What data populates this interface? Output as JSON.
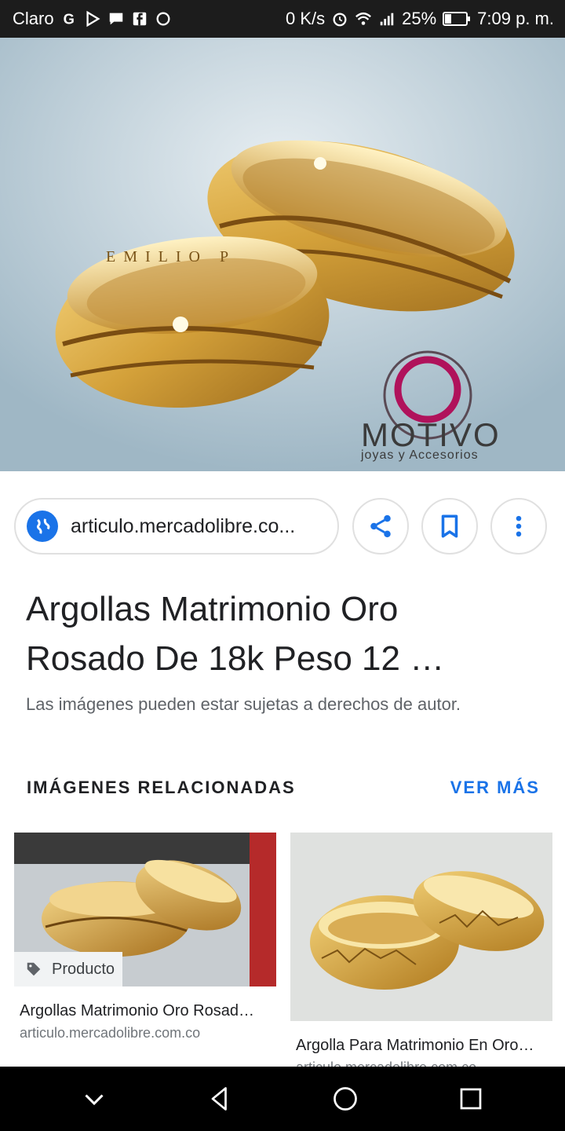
{
  "status_bar": {
    "carrier": "Claro",
    "net_speed": "0 K/s",
    "battery": "25%",
    "time": "7:09 p. m."
  },
  "hero": {
    "brand": "MOTIVO",
    "brand_sub": "joyas y Accesorios",
    "engraving": "EMILIO P"
  },
  "actions": {
    "url": "articulo.mercadolibre.co..."
  },
  "title": {
    "line1": "Argollas Matrimonio Oro",
    "line2": "Rosado De 18k Peso 12 …"
  },
  "copyright_notice": "Las imágenes pueden estar sujetas a derechos de autor.",
  "related": {
    "heading": "IMÁGENES RELACIONADAS",
    "more": "VER MÁS",
    "items": [
      {
        "tag": "Producto",
        "title": "Argollas Matrimonio Oro Rosad…",
        "source": "articulo.mercadolibre.com.co"
      },
      {
        "title": "Argolla Para Matrimonio En Oro…",
        "source": "articulo.mercadolibre.com.co"
      }
    ]
  },
  "colors": {
    "accent": "#1a73e8",
    "gold": "#d4a13a"
  }
}
